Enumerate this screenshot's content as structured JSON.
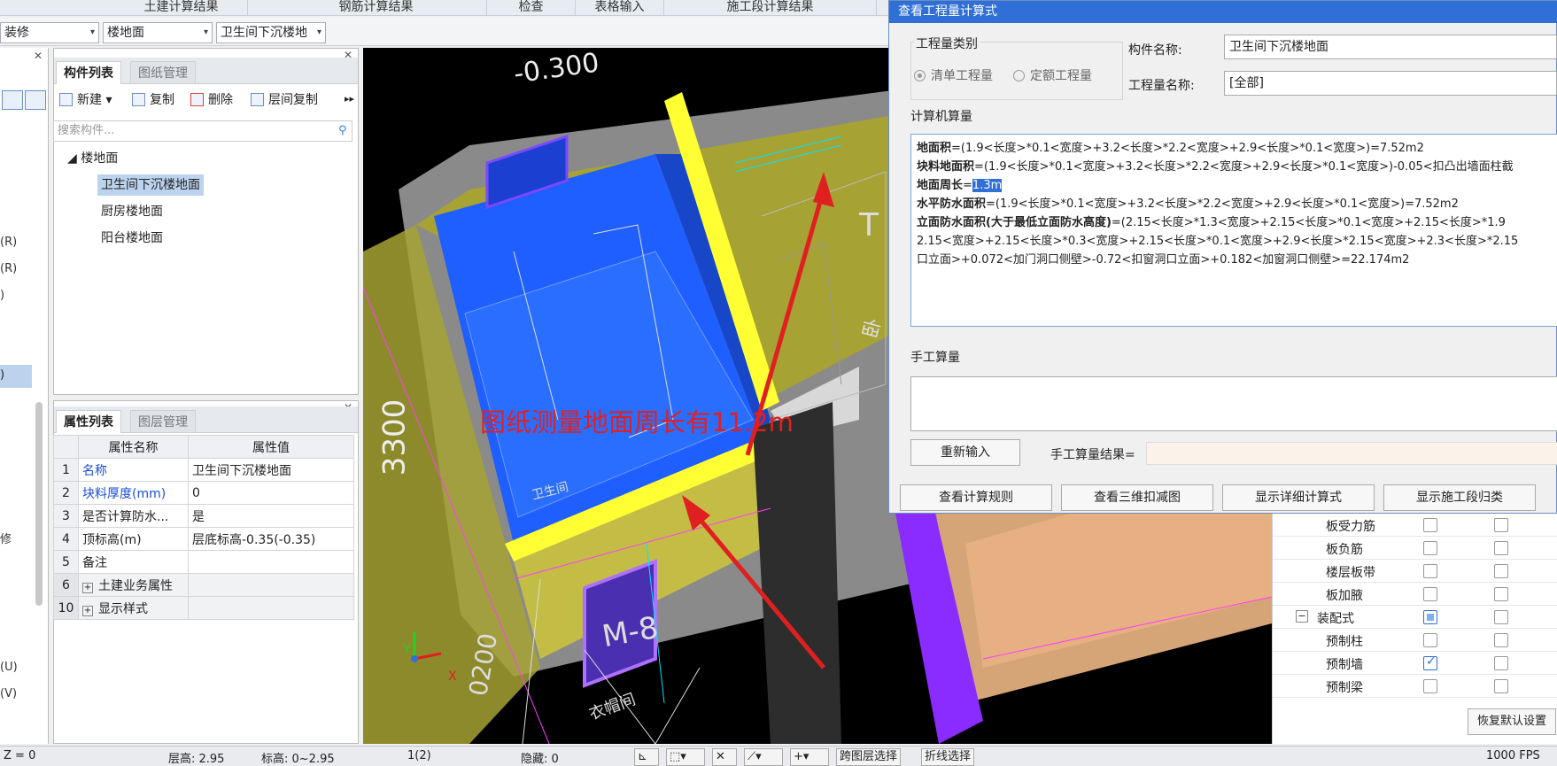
{
  "menubar": {
    "items": [
      "土建计算结果",
      "钢筋计算结果",
      "检查",
      "表格输入",
      "施工段计算结果"
    ]
  },
  "combos": [
    "装修",
    "楼地面",
    "卫生间下沉楼地"
  ],
  "left_strip": {
    "items": [
      "(R)",
      "(R)",
      ")",
      ")",
      "修",
      "(U)",
      "(V)"
    ]
  },
  "component_panel": {
    "tabs": [
      "构件列表",
      "图纸管理"
    ],
    "toolbar": {
      "new": "新建",
      "copy": "复制",
      "delete": "删除",
      "floor_copy": "层间复制"
    },
    "search_placeholder": "搜索构件...",
    "tree": {
      "root": "楼地面",
      "items": [
        "卫生间下沉楼地面",
        "厨房楼地面",
        "阳台楼地面"
      ]
    }
  },
  "property_panel": {
    "tabs": [
      "属性列表",
      "图层管理"
    ],
    "headers": [
      "属性名称",
      "属性值"
    ],
    "rows": [
      {
        "num": "1",
        "name": "名称",
        "value": "卫生间下沉楼地面"
      },
      {
        "num": "2",
        "name": "块料厚度(mm)",
        "value": "0"
      },
      {
        "num": "3",
        "name": "是否计算防水...",
        "value": "是"
      },
      {
        "num": "4",
        "name": "顶标高(m)",
        "value": "层底标高-0.35(-0.35)"
      },
      {
        "num": "5",
        "name": "备注",
        "value": ""
      },
      {
        "num": "6",
        "name": "土建业务属性",
        "value": ""
      },
      {
        "num": "10",
        "name": "显示样式",
        "value": ""
      }
    ]
  },
  "viewport": {
    "label_elev": "-0.300",
    "label_3300": "3300",
    "label_room": "卫生间",
    "label_door": "M-8",
    "label_closet": "衣帽间",
    "label_kitchen": "卧",
    "label_bottom": "0200",
    "label_t": "T",
    "annotation": "图纸测量地面周长有11.2m",
    "axis_x": "X",
    "axis_y": "Y"
  },
  "dialog": {
    "title": "查看工程量计算式",
    "qty_type_label": "工程量类别",
    "radio_bill": "清单工程量",
    "radio_quota": "定额工程量",
    "component_name_label": "构件名称:",
    "component_name_value": "卫生间下沉楼地面",
    "qty_name_label": "工程量名称:",
    "qty_name_value": "[全部]",
    "computer_calc_label": "计算机算量",
    "lines": [
      {
        "b": "地面积",
        "t": "=(1.9<长度>*0.1<宽度>+3.2<长度>*2.2<宽度>+2.9<长度>*0.1<宽度>)=7.52m2"
      },
      {
        "b": "块料地面积",
        "t": "=(1.9<长度>*0.1<宽度>+3.2<长度>*2.2<宽度>+2.9<长度>*0.1<宽度>)-0.05<扣凸出墙面柱截"
      },
      {
        "b": "地面周长",
        "t": "=",
        "hl": "1.3m"
      },
      {
        "b": "水平防水面积",
        "t": "=(1.9<长度>*0.1<宽度>+3.2<长度>*2.2<宽度>+2.9<长度>*0.1<宽度>)=7.52m2"
      },
      {
        "b": "立面防水面积(大于最低立面防水高度)",
        "t": "=(2.15<长度>*1.3<宽度>+2.15<长度>*0.1<宽度>+2.15<长度>*1.9"
      },
      {
        "b": "",
        "t": "2.15<宽度>+2.15<长度>*0.3<宽度>+2.15<长度>*0.1<宽度>+2.9<长度>*2.15<宽度>+2.3<长度>*2.15"
      },
      {
        "b": "",
        "t": "口立面>+0.072<加门洞口侧壁>-0.72<扣窗洞口立面>+0.182<加窗洞口侧壁>=22.174m2"
      }
    ],
    "manual_calc_label": "手工算量",
    "reenter": "重新输入",
    "manual_result_label": "手工算量结果=",
    "buttons": [
      "查看计算规则",
      "查看三维扣减图",
      "显示详细计算式",
      "显示施工段归类"
    ]
  },
  "right_panel": {
    "rows": [
      {
        "name": "板受力筋",
        "c1": "off",
        "c2": "off"
      },
      {
        "name": "板负筋",
        "c1": "off",
        "c2": "off"
      },
      {
        "name": "楼层板带",
        "c1": "off",
        "c2": "off"
      },
      {
        "name": "板加腋",
        "c1": "off",
        "c2": "off"
      },
      {
        "name": "装配式",
        "c1": "part",
        "c2": "off"
      },
      {
        "name": "预制柱",
        "c1": "off",
        "c2": "off"
      },
      {
        "name": "预制墙",
        "c1": "on",
        "c2": "off"
      },
      {
        "name": "预制梁",
        "c1": "off",
        "c2": "off"
      }
    ],
    "restore_button": "恢复默认设置"
  },
  "statusbar": {
    "z": "Z = 0",
    "floor_height": "层高: 2.95",
    "elevation": "标高: 0~2.95",
    "page": "1(2)",
    "hidden": "隐藏: 0",
    "cross_layer": "跨图层选择",
    "polyline": "折线选择",
    "fps": "1000 FPS"
  },
  "colors": {
    "accent": "#2f6fd6",
    "annotation": "#e02020",
    "floor_blue": "#1f5fff",
    "wall_olive": "#a6a233"
  }
}
